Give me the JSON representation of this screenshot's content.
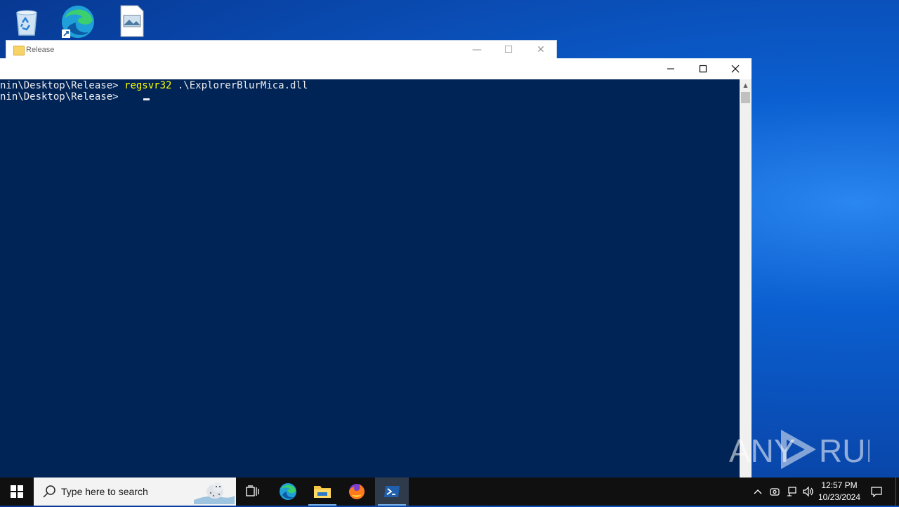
{
  "desktop": {
    "icons": [
      {
        "name": "recycle-bin"
      },
      {
        "name": "microsoft-edge"
      },
      {
        "name": "image-file"
      }
    ]
  },
  "explorer_window": {
    "title": "Release"
  },
  "powershell": {
    "console": {
      "line1_prompt": "nin\\Desktop\\Release> ",
      "line1_command": "regsvr32",
      "line1_args": " .\\ExplorerBlurMica.dll",
      "line2_prompt": "nin\\Desktop\\Release> "
    },
    "colors": {
      "background": "#012456",
      "text": "#eeedf0",
      "command": "#ffff00"
    }
  },
  "watermark": {
    "text": "ANY RUN"
  },
  "taskbar": {
    "search_placeholder": "Type here to search",
    "apps": [
      "task-view",
      "microsoft-edge",
      "file-explorer",
      "firefox",
      "powershell"
    ],
    "clock_time": "12:57 PM",
    "clock_date": "10/23/2024"
  }
}
